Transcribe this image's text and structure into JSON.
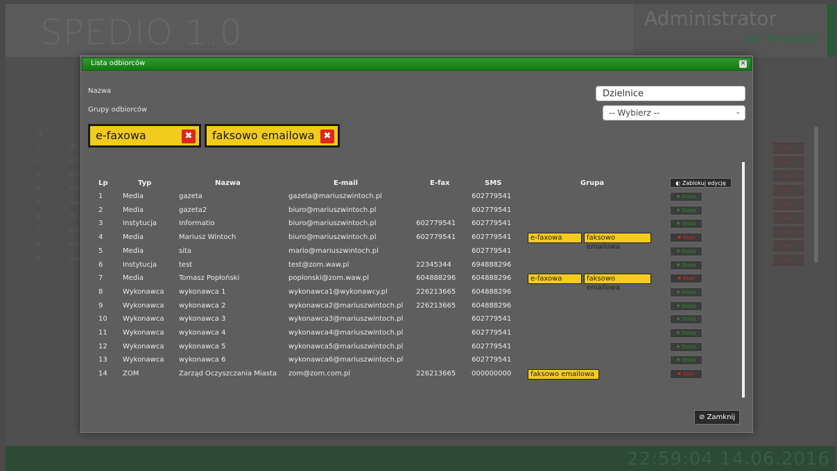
{
  "app": {
    "logo": "SPEDIO 1.0",
    "user_role": "Administrator",
    "user_name": "Jan Kowalski",
    "clock": "22:59:04 14.06.2016",
    "bg_list": {
      "header_lp": "Lp",
      "rows": [
        {
          "lp": "1",
          "text": "Dz"
        },
        {
          "lp": "2",
          "text": "e-f"
        },
        {
          "lp": "3",
          "text": "e-m"
        },
        {
          "lp": "4",
          "text": "em"
        },
        {
          "lp": "5",
          "text": "fak"
        },
        {
          "lp": "6",
          "text": "Po"
        },
        {
          "lp": "7",
          "text": "sm"
        },
        {
          "lp": "8",
          "text": "sm"
        },
        {
          "lp": "9",
          "text": "ws"
        }
      ],
      "button_label": "Usuń"
    }
  },
  "modal": {
    "title": "Lista odbiorców",
    "close_icon": "close-icon",
    "name_label": "Nazwa",
    "name_value": "Dzielnice",
    "groups_label": "Grupy odbiorców",
    "group_select_value": "-- Wybierz --",
    "selected_groups": [
      "e-faxowa",
      "faksowo emailowa"
    ],
    "lock_button_label": "Zablokuj edycję",
    "close_button_label": "Zamknij",
    "table": {
      "headers": [
        "Lp",
        "Typ",
        "Nazwa",
        "E-mail",
        "E-fax",
        "SMS",
        "Grupa"
      ],
      "rows": [
        {
          "lp": "1",
          "typ": "Media",
          "nazwa": "gazeta",
          "email": "gazeta@mariuszwintoch.pl",
          "efax": "",
          "sms": "602779541",
          "groups": [],
          "action": "Dodaj"
        },
        {
          "lp": "2",
          "typ": "Media",
          "nazwa": "gazeta2",
          "email": "biuro@mariuszwintoch.pl",
          "efax": "",
          "sms": "602779541",
          "groups": [],
          "action": "Dodaj"
        },
        {
          "lp": "3",
          "typ": "Instytucja",
          "nazwa": "Informatio",
          "email": "biuro@mariuszwintoch.pl",
          "efax": "602779541",
          "sms": "602779541",
          "groups": [],
          "action": "Dodaj"
        },
        {
          "lp": "4",
          "typ": "Media",
          "nazwa": "Mariusz Wintoch",
          "email": "biuro@mariuszwintoch.pl",
          "efax": "602779541",
          "sms": "602779541",
          "groups": [
            "e-faxowa",
            "faksowo emailowa"
          ],
          "action": "Usuń"
        },
        {
          "lp": "5",
          "typ": "Media",
          "nazwa": "sita",
          "email": "mario@mariuszwintoch.pl",
          "efax": "",
          "sms": "602779541",
          "groups": [],
          "action": "Dodaj"
        },
        {
          "lp": "6",
          "typ": "Instytucja",
          "nazwa": "test",
          "email": "test@zom.waw.pl",
          "efax": "22345344",
          "sms": "694888296",
          "groups": [],
          "action": "Dodaj"
        },
        {
          "lp": "7",
          "typ": "Media",
          "nazwa": "Tomasz Popłoński",
          "email": "poplonski@zom.waw.pl",
          "efax": "604888296",
          "sms": "604888296",
          "groups": [
            "e-faxowa",
            "faksowo emailowa"
          ],
          "action": "Usuń"
        },
        {
          "lp": "8",
          "typ": "Wykonawca",
          "nazwa": "wykonawca 1",
          "email": "wykonawca1@wykonawcy.pl",
          "efax": "226213665",
          "sms": "604888296",
          "groups": [],
          "action": "Dodaj"
        },
        {
          "lp": "9",
          "typ": "Wykonawca",
          "nazwa": "wykonawca 2",
          "email": "wykonawca2@mariuszwintoch.pl",
          "efax": "226213665",
          "sms": "604888296",
          "groups": [],
          "action": "Dodaj"
        },
        {
          "lp": "10",
          "typ": "Wykonawca",
          "nazwa": "wykonawca 3",
          "email": "wykonawca3@mariuszwintoch.pl",
          "efax": "",
          "sms": "602779541",
          "groups": [],
          "action": "Dodaj"
        },
        {
          "lp": "11",
          "typ": "Wykonawca",
          "nazwa": "wykonawca 4",
          "email": "wykonawca4@mariuszwintoch.pl",
          "efax": "",
          "sms": "602779541",
          "groups": [],
          "action": "Dodaj"
        },
        {
          "lp": "12",
          "typ": "Wykonawca",
          "nazwa": "wykonawca 5",
          "email": "wykonawca5@mariuszwintoch.pl",
          "efax": "",
          "sms": "602779541",
          "groups": [],
          "action": "Dodaj"
        },
        {
          "lp": "13",
          "typ": "Wykonawca",
          "nazwa": "wykonawca 6",
          "email": "wykonawca6@mariuszwintoch.pl",
          "efax": "",
          "sms": "602779541",
          "groups": [],
          "action": "Dodaj"
        },
        {
          "lp": "14",
          "typ": "ZOM",
          "nazwa": "Zarząd Oczyszczania Miasta",
          "email": "zom@zom.com.pl",
          "efax": "226213665",
          "sms": "000000000",
          "groups": [
            "faksowo emailowa"
          ],
          "action": "Usuń"
        }
      ]
    }
  },
  "colors": {
    "title_green": "#1e8a1e",
    "chip_yellow": "#f2cb1d",
    "delete_red": "#e0261b",
    "add_green": "#2f8a2f"
  }
}
